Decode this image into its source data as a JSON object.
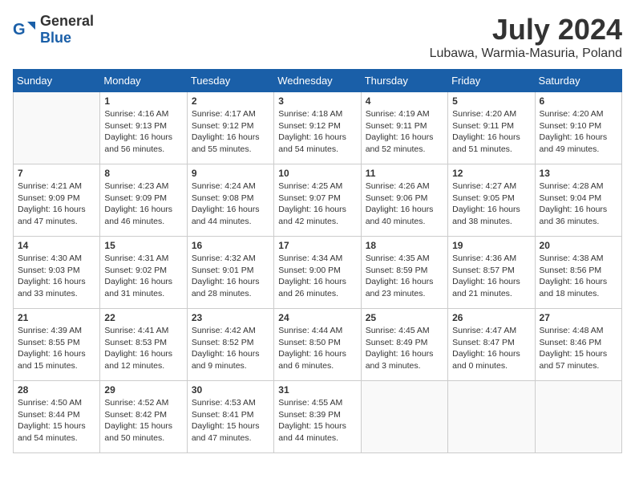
{
  "header": {
    "logo_general": "General",
    "logo_blue": "Blue",
    "month_year": "July 2024",
    "location": "Lubawa, Warmia-Masuria, Poland"
  },
  "weekdays": [
    "Sunday",
    "Monday",
    "Tuesday",
    "Wednesday",
    "Thursday",
    "Friday",
    "Saturday"
  ],
  "weeks": [
    [
      {
        "day": "",
        "info": ""
      },
      {
        "day": "1",
        "info": "Sunrise: 4:16 AM\nSunset: 9:13 PM\nDaylight: 16 hours\nand 56 minutes."
      },
      {
        "day": "2",
        "info": "Sunrise: 4:17 AM\nSunset: 9:12 PM\nDaylight: 16 hours\nand 55 minutes."
      },
      {
        "day": "3",
        "info": "Sunrise: 4:18 AM\nSunset: 9:12 PM\nDaylight: 16 hours\nand 54 minutes."
      },
      {
        "day": "4",
        "info": "Sunrise: 4:19 AM\nSunset: 9:11 PM\nDaylight: 16 hours\nand 52 minutes."
      },
      {
        "day": "5",
        "info": "Sunrise: 4:20 AM\nSunset: 9:11 PM\nDaylight: 16 hours\nand 51 minutes."
      },
      {
        "day": "6",
        "info": "Sunrise: 4:20 AM\nSunset: 9:10 PM\nDaylight: 16 hours\nand 49 minutes."
      }
    ],
    [
      {
        "day": "7",
        "info": "Sunrise: 4:21 AM\nSunset: 9:09 PM\nDaylight: 16 hours\nand 47 minutes."
      },
      {
        "day": "8",
        "info": "Sunrise: 4:23 AM\nSunset: 9:09 PM\nDaylight: 16 hours\nand 46 minutes."
      },
      {
        "day": "9",
        "info": "Sunrise: 4:24 AM\nSunset: 9:08 PM\nDaylight: 16 hours\nand 44 minutes."
      },
      {
        "day": "10",
        "info": "Sunrise: 4:25 AM\nSunset: 9:07 PM\nDaylight: 16 hours\nand 42 minutes."
      },
      {
        "day": "11",
        "info": "Sunrise: 4:26 AM\nSunset: 9:06 PM\nDaylight: 16 hours\nand 40 minutes."
      },
      {
        "day": "12",
        "info": "Sunrise: 4:27 AM\nSunset: 9:05 PM\nDaylight: 16 hours\nand 38 minutes."
      },
      {
        "day": "13",
        "info": "Sunrise: 4:28 AM\nSunset: 9:04 PM\nDaylight: 16 hours\nand 36 minutes."
      }
    ],
    [
      {
        "day": "14",
        "info": "Sunrise: 4:30 AM\nSunset: 9:03 PM\nDaylight: 16 hours\nand 33 minutes."
      },
      {
        "day": "15",
        "info": "Sunrise: 4:31 AM\nSunset: 9:02 PM\nDaylight: 16 hours\nand 31 minutes."
      },
      {
        "day": "16",
        "info": "Sunrise: 4:32 AM\nSunset: 9:01 PM\nDaylight: 16 hours\nand 28 minutes."
      },
      {
        "day": "17",
        "info": "Sunrise: 4:34 AM\nSunset: 9:00 PM\nDaylight: 16 hours\nand 26 minutes."
      },
      {
        "day": "18",
        "info": "Sunrise: 4:35 AM\nSunset: 8:59 PM\nDaylight: 16 hours\nand 23 minutes."
      },
      {
        "day": "19",
        "info": "Sunrise: 4:36 AM\nSunset: 8:57 PM\nDaylight: 16 hours\nand 21 minutes."
      },
      {
        "day": "20",
        "info": "Sunrise: 4:38 AM\nSunset: 8:56 PM\nDaylight: 16 hours\nand 18 minutes."
      }
    ],
    [
      {
        "day": "21",
        "info": "Sunrise: 4:39 AM\nSunset: 8:55 PM\nDaylight: 16 hours\nand 15 minutes."
      },
      {
        "day": "22",
        "info": "Sunrise: 4:41 AM\nSunset: 8:53 PM\nDaylight: 16 hours\nand 12 minutes."
      },
      {
        "day": "23",
        "info": "Sunrise: 4:42 AM\nSunset: 8:52 PM\nDaylight: 16 hours\nand 9 minutes."
      },
      {
        "day": "24",
        "info": "Sunrise: 4:44 AM\nSunset: 8:50 PM\nDaylight: 16 hours\nand 6 minutes."
      },
      {
        "day": "25",
        "info": "Sunrise: 4:45 AM\nSunset: 8:49 PM\nDaylight: 16 hours\nand 3 minutes."
      },
      {
        "day": "26",
        "info": "Sunrise: 4:47 AM\nSunset: 8:47 PM\nDaylight: 16 hours\nand 0 minutes."
      },
      {
        "day": "27",
        "info": "Sunrise: 4:48 AM\nSunset: 8:46 PM\nDaylight: 15 hours\nand 57 minutes."
      }
    ],
    [
      {
        "day": "28",
        "info": "Sunrise: 4:50 AM\nSunset: 8:44 PM\nDaylight: 15 hours\nand 54 minutes."
      },
      {
        "day": "29",
        "info": "Sunrise: 4:52 AM\nSunset: 8:42 PM\nDaylight: 15 hours\nand 50 minutes."
      },
      {
        "day": "30",
        "info": "Sunrise: 4:53 AM\nSunset: 8:41 PM\nDaylight: 15 hours\nand 47 minutes."
      },
      {
        "day": "31",
        "info": "Sunrise: 4:55 AM\nSunset: 8:39 PM\nDaylight: 15 hours\nand 44 minutes."
      },
      {
        "day": "",
        "info": ""
      },
      {
        "day": "",
        "info": ""
      },
      {
        "day": "",
        "info": ""
      }
    ]
  ]
}
